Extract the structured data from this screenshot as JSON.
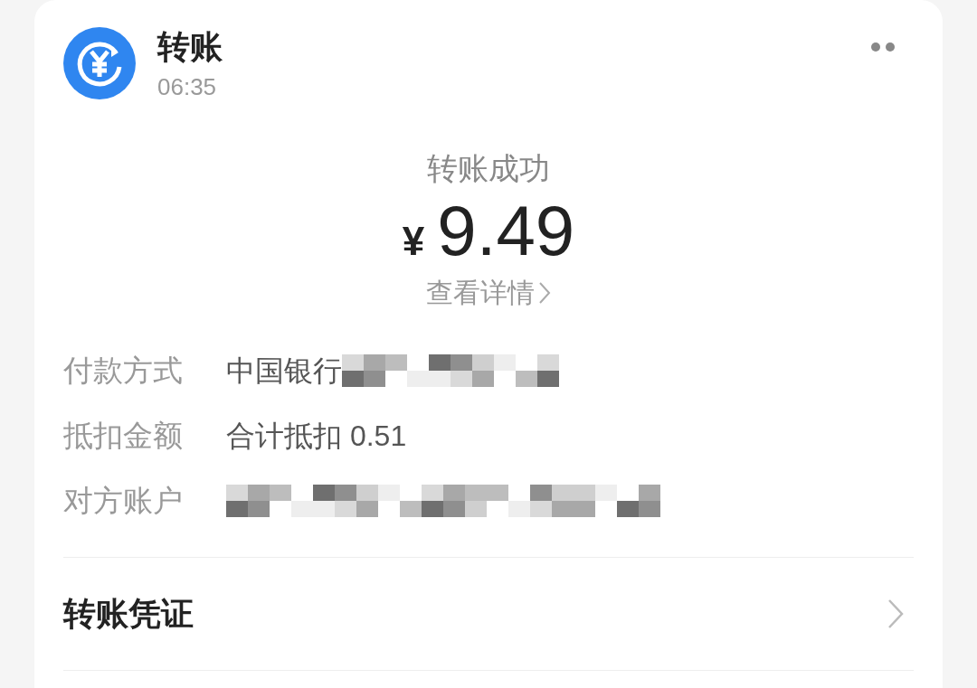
{
  "header": {
    "title": "转账",
    "time": "06:35"
  },
  "result": {
    "status": "转账成功",
    "currency": "¥",
    "amount": "9.49",
    "details_link": "查看详情"
  },
  "fields": [
    {
      "label": "付款方式",
      "value": "中国银行",
      "redacted": true
    },
    {
      "label": "抵扣金额",
      "value": "合计抵扣 0.51",
      "redacted": false
    },
    {
      "label": "对方账户",
      "redacted": true
    }
  ],
  "actions": [
    {
      "label": "转账凭证"
    }
  ]
}
